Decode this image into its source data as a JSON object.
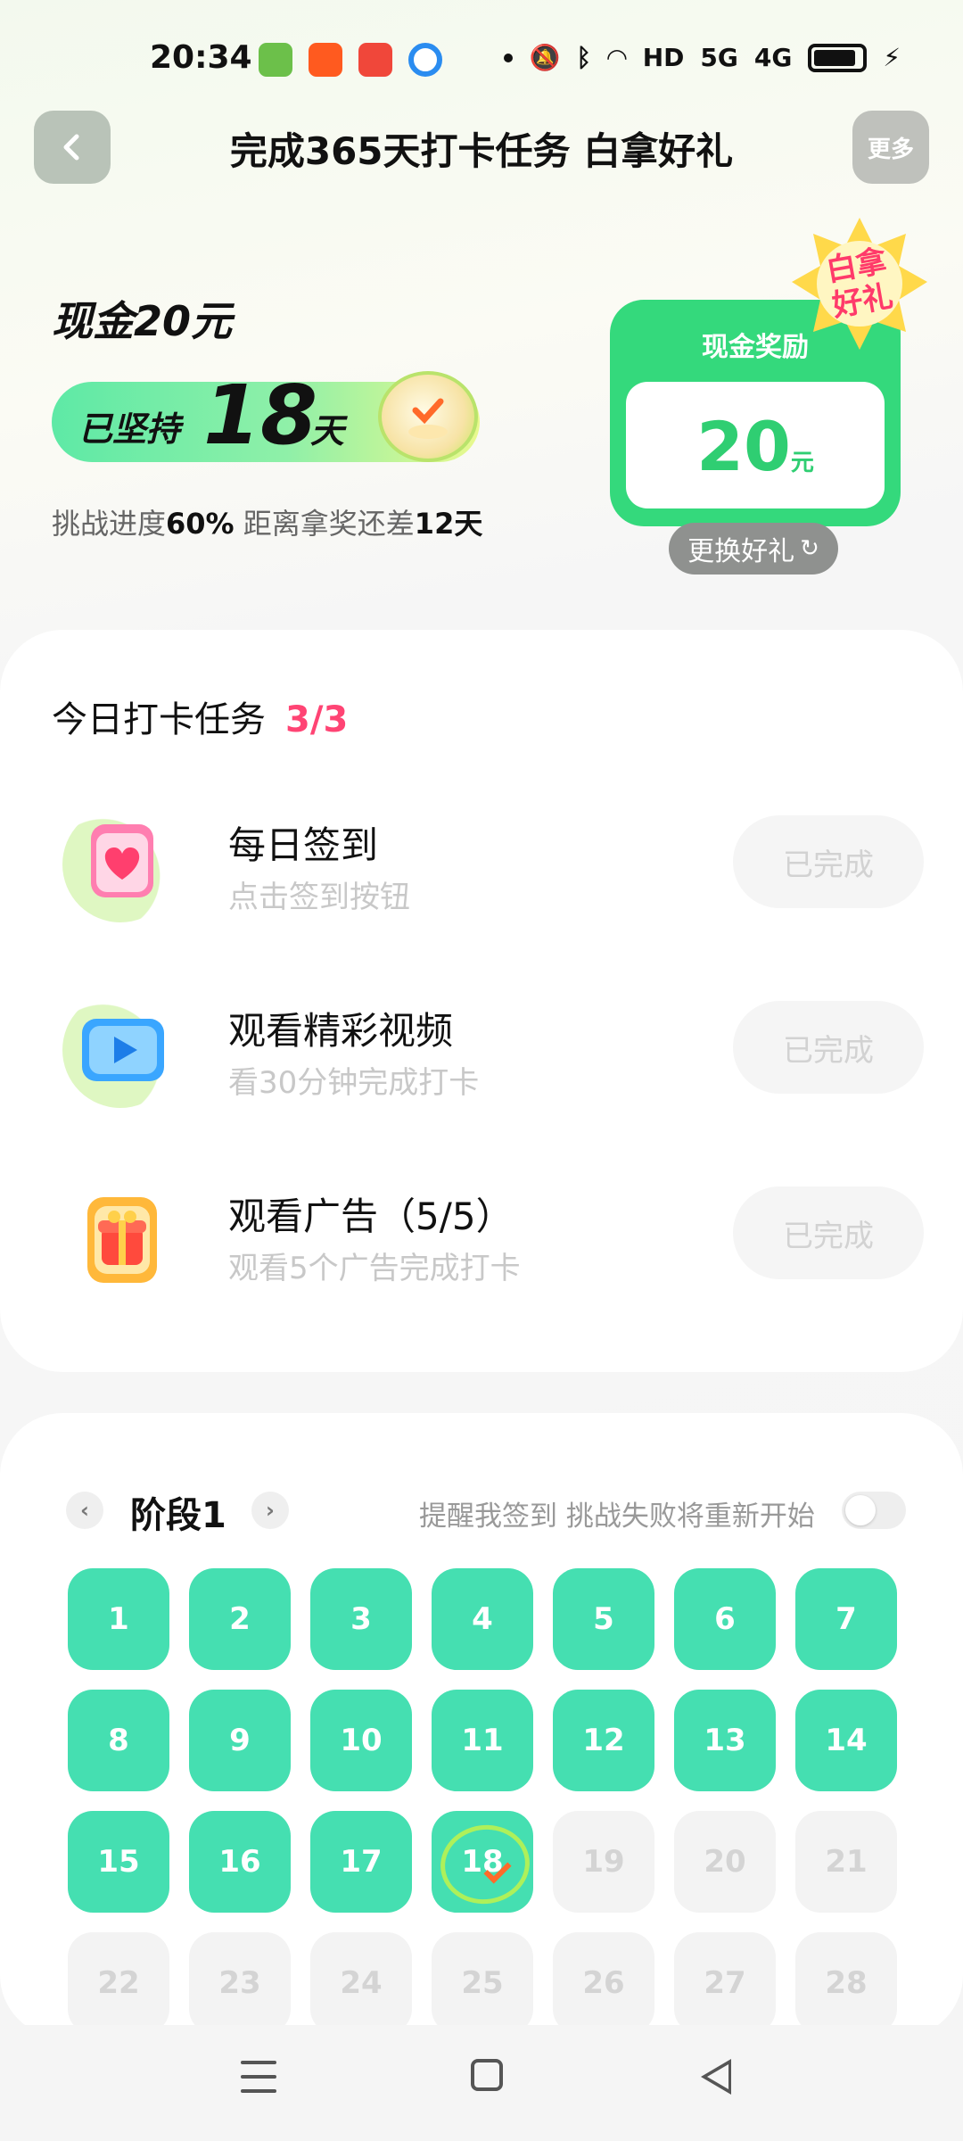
{
  "status_bar": {
    "time": "20:34",
    "notification_icons": [
      "android-app-icon",
      "taobao-icon",
      "music-icon",
      "browser-icon"
    ],
    "network_label": "HD",
    "signal1_label": "5G",
    "signal2_label": "4G",
    "battery_level": 0.9
  },
  "header": {
    "title": "完成365天打卡任务 白拿好礼",
    "more_label": "更多"
  },
  "summary": {
    "cash_title": "现金20元",
    "streak_prefix": "已坚持",
    "streak_days": "18",
    "streak_unit": "天",
    "progress_prefix": "挑战进度",
    "progress_percent": "60%",
    "progress_mid": " 距离拿奖还差",
    "progress_remaining": "12天"
  },
  "reward": {
    "card_title": "现金奖励",
    "amount": "20",
    "unit": "元",
    "badge_line1": "白拿",
    "badge_line2": "好礼",
    "change_label": "更换好礼"
  },
  "tasks": {
    "title": "今日打卡任务",
    "count": "3/3",
    "items": [
      {
        "name": "每日签到",
        "desc": "点击签到按钮",
        "button": "已完成",
        "icon": "calendar-heart-icon"
      },
      {
        "name": "观看精彩视频",
        "desc": "看30分钟完成打卡",
        "button": "已完成",
        "icon": "video-play-icon"
      },
      {
        "name": "观看广告（5/5）",
        "desc": "观看5个广告完成打卡",
        "button": "已完成",
        "icon": "gift-box-icon"
      }
    ]
  },
  "calendar": {
    "stage_label": "阶段1",
    "remind_text": "提醒我签到 挑战失败将重新开始",
    "reminder_on": false,
    "days": [
      "1",
      "2",
      "3",
      "4",
      "5",
      "6",
      "7",
      "8",
      "9",
      "10",
      "11",
      "12",
      "13",
      "14",
      "15",
      "16",
      "17",
      "18",
      "19",
      "20",
      "21",
      "22",
      "23",
      "24",
      "25",
      "26",
      "27",
      "28"
    ],
    "completed_through": 18,
    "today": 18
  },
  "colors": {
    "accent_green": "#34d97c",
    "day_done": "#45dfb1",
    "count_pink": "#ff4474"
  }
}
